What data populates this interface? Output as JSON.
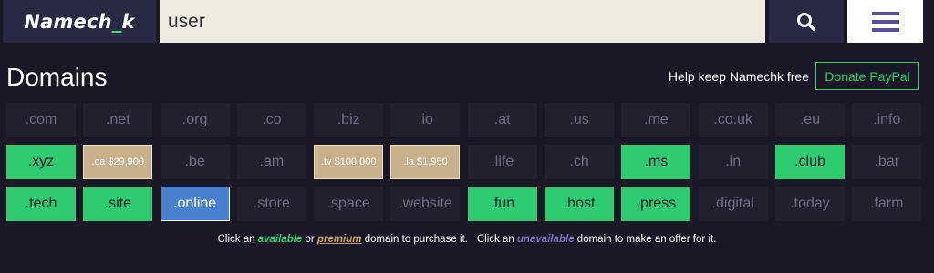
{
  "header": {
    "logo_left": "Namech",
    "logo_underscore": "_",
    "logo_right": "k",
    "search_value": "user",
    "search_icon": "search-icon",
    "menu_icon": "hamburger-menu-icon"
  },
  "section": {
    "title": "Domains",
    "keep_free": "Help keep Namechk free",
    "donate_label": "Donate PayPal"
  },
  "domains": [
    {
      "label": ".com",
      "status": "unavailable"
    },
    {
      "label": ".net",
      "status": "unavailable"
    },
    {
      "label": ".org",
      "status": "unavailable"
    },
    {
      "label": ".co",
      "status": "unavailable"
    },
    {
      "label": ".biz",
      "status": "unavailable"
    },
    {
      "label": ".io",
      "status": "unavailable"
    },
    {
      "label": ".at",
      "status": "unavailable"
    },
    {
      "label": ".us",
      "status": "unavailable"
    },
    {
      "label": ".me",
      "status": "unavailable"
    },
    {
      "label": ".co.uk",
      "status": "unavailable"
    },
    {
      "label": ".eu",
      "status": "unavailable"
    },
    {
      "label": ".info",
      "status": "unavailable"
    },
    {
      "label": ".xyz",
      "status": "available"
    },
    {
      "label": ".ca $29,900",
      "status": "premium"
    },
    {
      "label": ".be",
      "status": "unavailable"
    },
    {
      "label": ".am",
      "status": "unavailable"
    },
    {
      "label": ".tv $100,000",
      "status": "premium"
    },
    {
      "label": ".la $1,950",
      "status": "premium"
    },
    {
      "label": ".life",
      "status": "unavailable"
    },
    {
      "label": ".ch",
      "status": "unavailable"
    },
    {
      "label": ".ms",
      "status": "available"
    },
    {
      "label": ".in",
      "status": "unavailable"
    },
    {
      "label": ".club",
      "status": "available"
    },
    {
      "label": ".bar",
      "status": "unavailable"
    },
    {
      "label": ".tech",
      "status": "available"
    },
    {
      "label": ".site",
      "status": "available"
    },
    {
      "label": ".online",
      "status": "selected"
    },
    {
      "label": ".store",
      "status": "unavailable"
    },
    {
      "label": ".space",
      "status": "unavailable"
    },
    {
      "label": ".website",
      "status": "unavailable"
    },
    {
      "label": ".fun",
      "status": "available"
    },
    {
      "label": ".host",
      "status": "available"
    },
    {
      "label": ".press",
      "status": "available"
    },
    {
      "label": ".digital",
      "status": "unavailable"
    },
    {
      "label": ".today",
      "status": "unavailable"
    },
    {
      "label": ".farm",
      "status": "unavailable"
    }
  ],
  "footnote": {
    "part1": "Click an ",
    "available": "available",
    "part2": " or ",
    "premium": "premium",
    "part3": " domain to purchase it.",
    "part4": "Click an ",
    "unavailable": "unavailable",
    "part5": " domain to make an offer for it."
  },
  "colors": {
    "background": "#1a1827",
    "available": "#2ecc71",
    "premium": "#c7b08a",
    "selected": "#4a80d0",
    "unavailable": "#22202f"
  }
}
